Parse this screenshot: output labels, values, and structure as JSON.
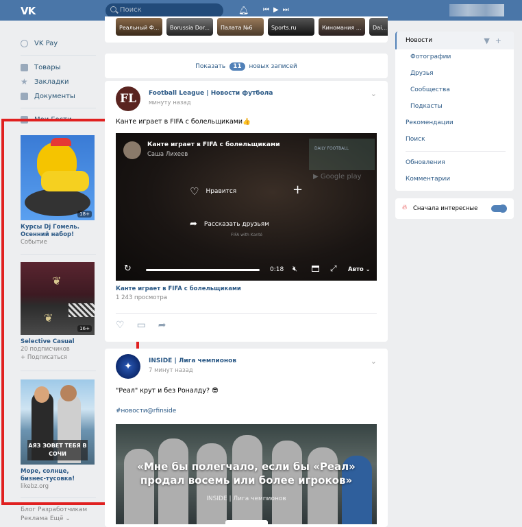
{
  "topbar": {
    "logo": "VK",
    "search_placeholder": "Поиск"
  },
  "leftnav": {
    "items": [
      {
        "label": "VK Pay",
        "icon": "vkpay-icon"
      },
      {
        "label": "Товары",
        "icon": "goods-icon"
      },
      {
        "label": "Закладки",
        "icon": "star-icon"
      },
      {
        "label": "Документы",
        "icon": "document-icon"
      },
      {
        "label": "Мои Гости",
        "icon": "grid-icon"
      }
    ]
  },
  "ads": [
    {
      "title": "Курсы Dj Гомель. Осенний набор!",
      "subtitle": "Событие",
      "age": "18+"
    },
    {
      "title": "Selective Casual",
      "subtitle": "20 подписчиков",
      "action": "+ Подписаться",
      "age": "16+"
    },
    {
      "title": "Море, солнце, бизнес-тусовка!",
      "subtitle": "likebz.org",
      "banner": "АЯЗ ЗОВЕТ ТЕБЯ В СОЧИ"
    }
  ],
  "footer": {
    "line1": "Блог   Разработчикам",
    "line2": "Реклама   Ещё ⌄"
  },
  "stories": [
    "Реальный Ф...",
    "Borussia Dor...",
    "Палата №6",
    "Sports.ru",
    "Киномания ...",
    "Dai..."
  ],
  "new_records": {
    "prefix": "Показать",
    "count": "11",
    "suffix": "новых записей"
  },
  "post1": {
    "author": "Football League | Новости футбола",
    "avatar_text": "FL",
    "time": "минуту назад",
    "text": "Канте играет в FIFA с болельщиками👍",
    "video": {
      "title": "Канте играет в FIFA с болельщиками",
      "author": "Саша Лихеев",
      "like_label": "Нравится",
      "share_label": "Рассказать друзьям",
      "watermark": "FIFA with Kanté",
      "daily_text": "DAILY FOOTBALL",
      "gplay_text": "Google play",
      "time": "0:18",
      "quality": "Авто ⌄"
    },
    "caption": "Канте играет в FIFA с болельщиками",
    "views": "1 243 просмотра"
  },
  "post2": {
    "author": "INSIDE | Лига чемпионов",
    "time": "7 минут назад",
    "text": "\"Реал\" крут и без Роналду? 😎",
    "tag": "#новости@rfinside",
    "quote": "«Мне бы полегчало, если бы «Реал» продал восемь или более игроков»",
    "quote_sub": "INSIDE | Лига чемпионов"
  },
  "rightpanel": {
    "news": "Новости",
    "subs": [
      "Фотографии",
      "Друзья",
      "Сообщества",
      "Подкасты"
    ],
    "items": [
      "Рекомендации",
      "Поиск"
    ],
    "items2": [
      "Обновления",
      "Комментарии"
    ]
  },
  "interesting_toggle": {
    "label": "Сначала интересные",
    "on": true
  }
}
